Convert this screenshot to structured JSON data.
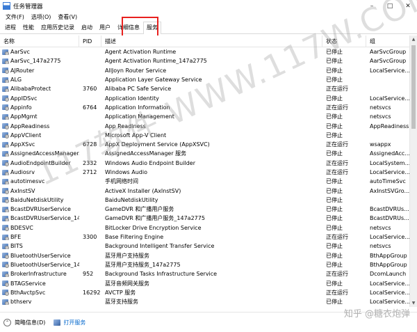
{
  "window": {
    "title": "任务管理器"
  },
  "menu": [
    "文件(F)",
    "选项(O)",
    "查看(V)"
  ],
  "tabs": [
    "进程",
    "性能",
    "应用历史记录",
    "启动",
    "用户",
    "详细信息",
    "服务"
  ],
  "active_tab": "服务",
  "columns": {
    "name": "名称",
    "pid": "PID",
    "desc": "描述",
    "status": "状态",
    "group": "组"
  },
  "rows": [
    {
      "name": "AarSvc",
      "pid": "",
      "desc": "Agent Activation Runtime",
      "status": "已停止",
      "group": "AarSvcGroup"
    },
    {
      "name": "AarSvc_147a2775",
      "pid": "",
      "desc": "Agent Activation Runtime_147a2775",
      "status": "已停止",
      "group": "AarSvcGroup"
    },
    {
      "name": "AJRouter",
      "pid": "",
      "desc": "AllJoyn Router Service",
      "status": "已停止",
      "group": "LocalService..."
    },
    {
      "name": "ALG",
      "pid": "",
      "desc": "Application Layer Gateway Service",
      "status": "已停止",
      "group": ""
    },
    {
      "name": "AlibabaProtect",
      "pid": "3760",
      "desc": "Alibaba PC Safe Service",
      "status": "正在运行",
      "group": ""
    },
    {
      "name": "AppIDSvc",
      "pid": "",
      "desc": "Application Identity",
      "status": "已停止",
      "group": "LocalService..."
    },
    {
      "name": "Appinfo",
      "pid": "6764",
      "desc": "Application Information",
      "status": "正在运行",
      "group": "netsvcs"
    },
    {
      "name": "AppMgmt",
      "pid": "",
      "desc": "Application Management",
      "status": "已停止",
      "group": "netsvcs"
    },
    {
      "name": "AppReadiness",
      "pid": "",
      "desc": "App Readiness",
      "status": "已停止",
      "group": "AppReadiness"
    },
    {
      "name": "AppVClient",
      "pid": "",
      "desc": "Microsoft App-V Client",
      "status": "已停止",
      "group": ""
    },
    {
      "name": "AppXSvc",
      "pid": "6728",
      "desc": "AppX Deployment Service (AppXSVC)",
      "status": "正在运行",
      "group": "wsappx"
    },
    {
      "name": "AssignedAccessManager...",
      "pid": "",
      "desc": "AssignedAccessManager 服务",
      "status": "已停止",
      "group": "AssignedAcc..."
    },
    {
      "name": "AudioEndpointBuilder",
      "pid": "2332",
      "desc": "Windows Audio Endpoint Builder",
      "status": "正在运行",
      "group": "LocalSystem..."
    },
    {
      "name": "Audiosrv",
      "pid": "2712",
      "desc": "Windows Audio",
      "status": "正在运行",
      "group": "LocalService..."
    },
    {
      "name": "autotimesvc",
      "pid": "",
      "desc": "手机网络时间",
      "status": "已停止",
      "group": "autoTimeSvc"
    },
    {
      "name": "AxInstSV",
      "pid": "",
      "desc": "ActiveX Installer (AxInstSV)",
      "status": "已停止",
      "group": "AxInstSVGro..."
    },
    {
      "name": "BaiduNetdiskUtility",
      "pid": "",
      "desc": "BaiduNetdiskUtility",
      "status": "已停止",
      "group": ""
    },
    {
      "name": "BcastDVRUserService",
      "pid": "",
      "desc": "GameDVR 和广播用户服务",
      "status": "已停止",
      "group": "BcastDVRUs..."
    },
    {
      "name": "BcastDVRUserService_14...",
      "pid": "",
      "desc": "GameDVR 和广播用户服务_147a2775",
      "status": "已停止",
      "group": "BcastDVRUs..."
    },
    {
      "name": "BDESVC",
      "pid": "",
      "desc": "BitLocker Drive Encryption Service",
      "status": "已停止",
      "group": "netsvcs"
    },
    {
      "name": "BFE",
      "pid": "3300",
      "desc": "Base Filtering Engine",
      "status": "正在运行",
      "group": "LocalService..."
    },
    {
      "name": "BITS",
      "pid": "",
      "desc": "Background Intelligent Transfer Service",
      "status": "已停止",
      "group": "netsvcs"
    },
    {
      "name": "BluetoothUserService",
      "pid": "",
      "desc": "蓝牙用户支持服务",
      "status": "已停止",
      "group": "BthAppGroup"
    },
    {
      "name": "BluetoothUserService_14...",
      "pid": "",
      "desc": "蓝牙用户支持服务_147a2775",
      "status": "已停止",
      "group": "BthAppGroup"
    },
    {
      "name": "BrokerInfrastructure",
      "pid": "952",
      "desc": "Background Tasks Infrastructure Service",
      "status": "正在运行",
      "group": "DcomLaunch"
    },
    {
      "name": "BTAGService",
      "pid": "",
      "desc": "蓝牙音频网关服务",
      "status": "已停止",
      "group": "LocalService..."
    },
    {
      "name": "BthAvctpSvc",
      "pid": "16292",
      "desc": "AVCTP 服务",
      "status": "正在运行",
      "group": "LocalService..."
    },
    {
      "name": "bthserv",
      "pid": "",
      "desc": "蓝牙支持服务",
      "status": "已停止",
      "group": "LocalService..."
    },
    {
      "name": "",
      "pid": "",
      "desc": "",
      "status": "",
      "group": ""
    }
  ],
  "statusbar": {
    "less_details": "简略信息(D)",
    "open_services": "打开服务"
  },
  "watermark": "117软件 WWW.117W.COM",
  "credit": "知乎 @糖衣炮弹",
  "colors": {
    "highlight_box": "#e8201e",
    "link": "#0066cc"
  }
}
